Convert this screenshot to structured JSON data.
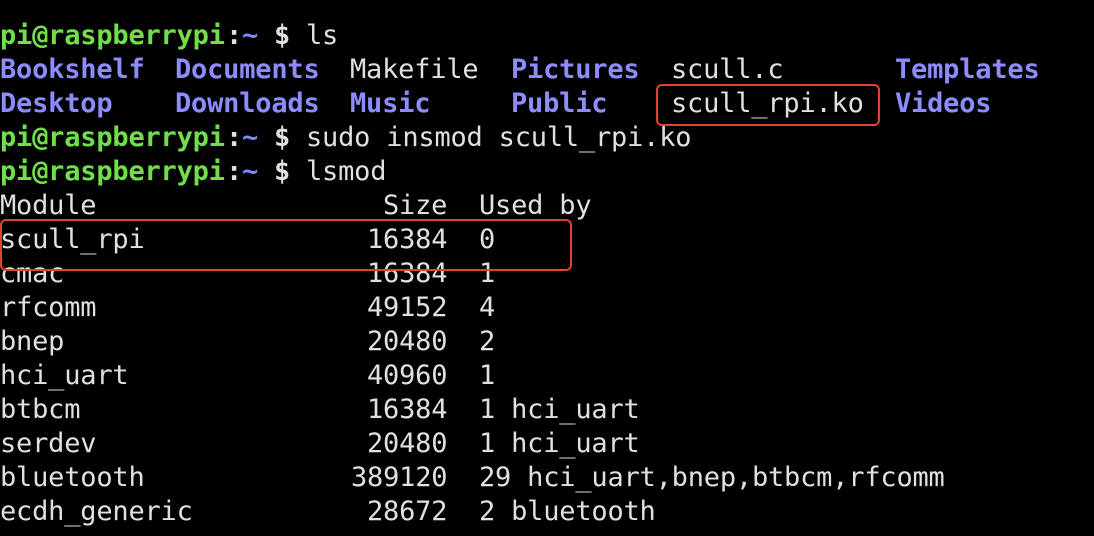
{
  "prompt": {
    "user": "pi@raspberrypi",
    "sep": ":",
    "path": "~",
    "dollar": "$"
  },
  "commands": {
    "ls": "ls",
    "insmod": "sudo insmod scull_rpi.ko",
    "lsmod": "lsmod"
  },
  "ls_output": {
    "row1": [
      "Bookshelf",
      "Documents",
      "Makefile",
      "Pictures",
      "scull.c",
      "Templates"
    ],
    "row2": [
      "Desktop",
      "Downloads",
      "Music",
      "Public",
      "scull_rpi.ko",
      "Videos"
    ]
  },
  "lsmod_header": {
    "module": "Module",
    "size": "Size",
    "used_by": "Used by"
  },
  "lsmod_rows": [
    {
      "module": "scull_rpi",
      "size": "16384",
      "used": "0"
    },
    {
      "module": "cmac",
      "size": "16384",
      "used": "1"
    },
    {
      "module": "rfcomm",
      "size": "49152",
      "used": "4"
    },
    {
      "module": "bnep",
      "size": "20480",
      "used": "2"
    },
    {
      "module": "hci_uart",
      "size": "40960",
      "used": "1"
    },
    {
      "module": "btbcm",
      "size": "16384",
      "used": "1 hci_uart"
    },
    {
      "module": "serdev",
      "size": "20480",
      "used": "1 hci_uart"
    },
    {
      "module": "bluetooth",
      "size": "389120",
      "used": "29 hci_uart,bnep,btbcm,rfcomm"
    },
    {
      "module": "ecdh_generic",
      "size": "28672",
      "used": "2 bluetooth"
    }
  ],
  "colors": {
    "background": "#000000",
    "prompt_user": "#6fe04a",
    "prompt_path": "#7a8cff",
    "directory": "#8c8cff",
    "text": "#e0e0e0",
    "highlight_box": "#e0442f"
  }
}
